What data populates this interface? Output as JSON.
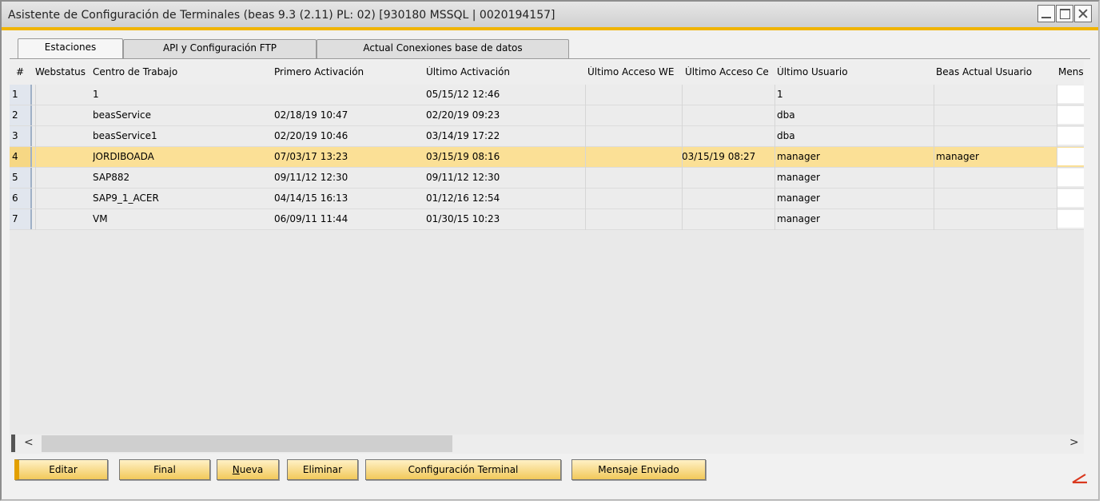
{
  "window": {
    "title": "Asistente de Configuración de Terminales (beas 9.3 (2.11) PL: 02) [930180 MSSQL | 0020194157]"
  },
  "tabs": [
    {
      "label": "Estaciones",
      "active": true
    },
    {
      "label": "API y Configuración FTP",
      "active": false
    },
    {
      "label": "Actual Conexiones base de datos",
      "active": false
    }
  ],
  "grid": {
    "columns": [
      "#",
      "Webstatus",
      "Centro de Trabajo",
      "Primero Activación",
      "Último Activación",
      "Último Acceso WE",
      "Último Acceso Ce",
      "Último Usuario",
      "Beas Actual Usuario",
      "Mens"
    ],
    "rows": [
      {
        "num": "1",
        "centro": "1",
        "primero": "",
        "ultimo": "05/15/12 12:46",
        "acceso_ce": "",
        "usuario": "1",
        "actual": ""
      },
      {
        "num": "2",
        "centro": "beasService",
        "primero": "02/18/19 10:47",
        "ultimo": "02/20/19 09:23",
        "acceso_ce": "",
        "usuario": "dba",
        "actual": ""
      },
      {
        "num": "3",
        "centro": "beasService1",
        "primero": "02/20/19 10:46",
        "ultimo": "03/14/19 17:22",
        "acceso_ce": "",
        "usuario": "dba",
        "actual": ""
      },
      {
        "num": "4",
        "centro": "JORDIBOADA",
        "primero": "07/03/17 13:23",
        "ultimo": "03/15/19 08:16",
        "acceso_ce": "03/15/19 08:27",
        "usuario": "manager",
        "actual": "manager"
      },
      {
        "num": "5",
        "centro": "SAP882",
        "primero": "09/11/12 12:30",
        "ultimo": "09/11/12 12:30",
        "acceso_ce": "",
        "usuario": "manager",
        "actual": ""
      },
      {
        "num": "6",
        "centro": "SAP9_1_ACER",
        "primero": "04/14/15 16:13",
        "ultimo": "01/12/16 12:54",
        "acceso_ce": "",
        "usuario": "manager",
        "actual": ""
      },
      {
        "num": "7",
        "centro": "VM",
        "primero": "06/09/11 11:44",
        "ultimo": "01/30/15 10:23",
        "acceso_ce": "",
        "usuario": "manager",
        "actual": ""
      }
    ],
    "selected_row": "4"
  },
  "scrollbar": {
    "left_arrow": "<",
    "right_arrow": ">"
  },
  "buttons": {
    "editar": "Editar",
    "final": "Final",
    "nueva_first": "N",
    "nueva_rest": "ueva",
    "eliminar": "Eliminar",
    "config_terminal": "Configuración Terminal",
    "mensaje": "Mensaje Enviado"
  },
  "colors": {
    "accent": "#f0b400",
    "selected_row": "#fbe096",
    "button": "#f2c95a"
  }
}
